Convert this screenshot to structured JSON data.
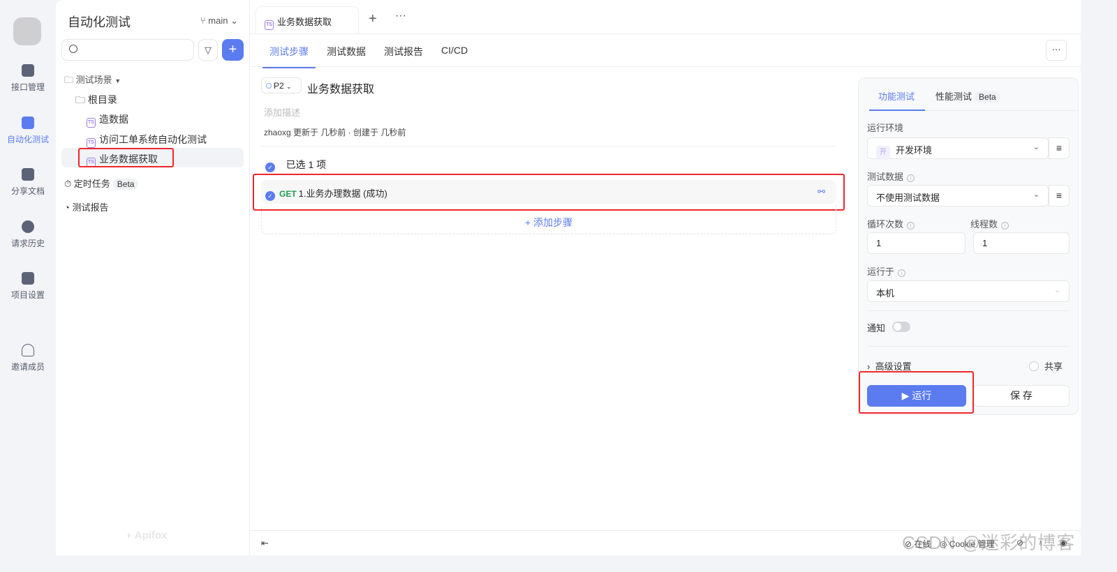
{
  "rail": {
    "items": [
      {
        "label": "接口管理",
        "icon": "api-icon"
      },
      {
        "label": "自动化测试",
        "icon": "automation-icon",
        "active": true
      },
      {
        "label": "分享文档",
        "icon": "share-doc-icon"
      },
      {
        "label": "请求历史",
        "icon": "history-icon"
      },
      {
        "label": "项目设置",
        "icon": "settings-icon"
      },
      {
        "label": "邀请成员",
        "icon": "invite-user-icon"
      }
    ]
  },
  "sidebar": {
    "title": "自动化测试",
    "branch": "main",
    "search_placeholder": "",
    "tree": {
      "scenes": "测试场景",
      "root": "根目录",
      "cases": [
        "造数据",
        "访问工单系统自动化测试",
        "业务数据获取"
      ],
      "schedule": "定时任务",
      "schedule_badge": "Beta",
      "report": "测试报告"
    },
    "brand": "Apifox"
  },
  "main": {
    "doc_tab": "业务数据获取",
    "subtabs": [
      "测试步骤",
      "测试数据",
      "测试报告",
      "CI/CD"
    ],
    "priority": "P2",
    "case_title": "业务数据获取",
    "desc_placeholder": "添加描述",
    "meta": "zhaoxg 更新于 几秒前 · 创建于 几秒前",
    "selected": "已选 1 项",
    "step": {
      "method": "GET",
      "name": "1.业务办理数据 (成功)"
    },
    "add_step": "+ 添加步骤"
  },
  "panel": {
    "tabs": [
      "功能测试",
      "性能测试"
    ],
    "beta": "Beta",
    "env_label": "运行环境",
    "env_tag": "开",
    "env_value": "开发环境",
    "data_label": "测试数据",
    "data_value": "不使用测试数据",
    "loop_label": "循环次数",
    "loop_value": "1",
    "thread_label": "线程数",
    "thread_value": "1",
    "runon_label": "运行于",
    "runon_value": "本机",
    "notify_label": "通知",
    "notify_on": false,
    "advanced": "高级设置",
    "share": "共享",
    "run": "运行",
    "save": "保 存"
  },
  "footer": {
    "online": "在线",
    "cookie": "Cookie 管理"
  },
  "watermark": "CSDN @迷彩的博客",
  "colors": {
    "accent": "#5b7cf0",
    "get": "#1f9b4d",
    "annotation": "#f0272a"
  }
}
